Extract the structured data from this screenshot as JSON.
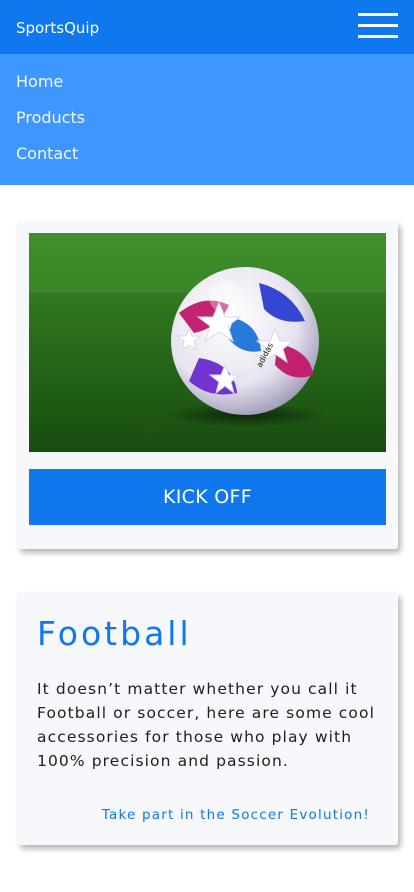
{
  "navbar": {
    "brand": "SportsQuip",
    "menu_icon": "hamburger-menu-icon"
  },
  "menu": {
    "items": [
      {
        "label": "Home"
      },
      {
        "label": "Products"
      },
      {
        "label": "Contact"
      }
    ]
  },
  "hero": {
    "image_subject": "soccer ball on grass",
    "button_label": "KICK OFF"
  },
  "info": {
    "title": "Football",
    "description": "It doesn’t matter whether you call it Football or soccer, here are some cool accessories for those who play with 100% precision and passion.",
    "cta": "Take part in the Soccer Evolution!"
  },
  "colors": {
    "primary": "#0f78ef",
    "menu_background": "#3d97ff",
    "card_background": "#f6f8fc"
  }
}
